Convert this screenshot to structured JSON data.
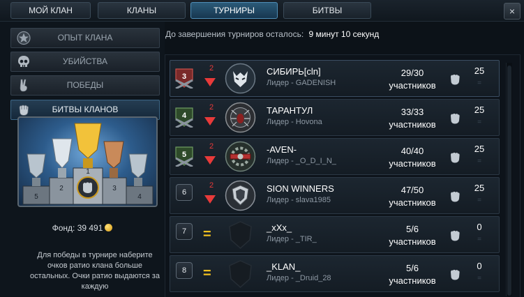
{
  "tabs": [
    {
      "label": "МОЙ КЛАН"
    },
    {
      "label": "КЛАНЫ"
    },
    {
      "label": "ТУРНИРЫ"
    },
    {
      "label": "БИТВЫ"
    }
  ],
  "close_label": "×",
  "sidebar": {
    "items": [
      {
        "label": "ОПЫТ КЛАНА",
        "icon": "star-badge-icon"
      },
      {
        "label": "УБИЙСТВА",
        "icon": "skull-icon"
      },
      {
        "label": "ПОБЕДЫ",
        "icon": "victory-hand-icon"
      },
      {
        "label": "БИТВЫ КЛАНОВ",
        "icon": "fist-icon"
      }
    ],
    "podium_numbers": [
      "2",
      "1",
      "3",
      "5",
      "4"
    ],
    "fund_label": "Фонд: 39 491",
    "description": "Для победы в турнире наберите очков ратио клана больше остальных. Очки ратио выдаются за каждую"
  },
  "timer": {
    "label": "До завершения турниров осталось:",
    "value": "9 минут 10 секунд"
  },
  "rows": [
    {
      "rank": "3",
      "change": "2",
      "change_dir": "down",
      "name": "СИБИРЬ[cln]",
      "leader": "Лидер - GADENISH",
      "count": "29/30",
      "count_label": "участников",
      "score": "25",
      "emblem": "wolf"
    },
    {
      "rank": "4",
      "change": "2",
      "change_dir": "down",
      "name": "ТАРАНТУЛ",
      "leader": "Лидер - Hovona",
      "count": "33/33",
      "count_label": "участников",
      "score": "25",
      "emblem": "spider"
    },
    {
      "rank": "5",
      "change": "2",
      "change_dir": "down",
      "name": "-AVEN-",
      "leader": "Лидер - _O_D_I_N_",
      "count": "40/40",
      "count_label": "участников",
      "score": "25",
      "emblem": "gear"
    },
    {
      "rank": "6",
      "change": "2",
      "change_dir": "down",
      "name": "SION WINNERS",
      "leader": "Лидер - slava1985",
      "count": "47/50",
      "count_label": "участников",
      "score": "25",
      "emblem": "shield"
    },
    {
      "rank": "7",
      "change": "=",
      "change_dir": "same",
      "name": "_xXx_",
      "leader": "Лидер - _TIR_",
      "count": "5/6",
      "count_label": "участников",
      "score": "0",
      "emblem": "none"
    },
    {
      "rank": "8",
      "change": "=",
      "change_dir": "same",
      "name": "_KLAN_",
      "leader": "Лидер - _Druid_28",
      "count": "5/6",
      "count_label": "участников",
      "score": "0",
      "emblem": "none"
    }
  ],
  "colors": {
    "accent_tab": "#2b5a78",
    "down_arrow": "#e83a3a",
    "equal_sign": "#f0c020",
    "coin": "#f0b020"
  }
}
